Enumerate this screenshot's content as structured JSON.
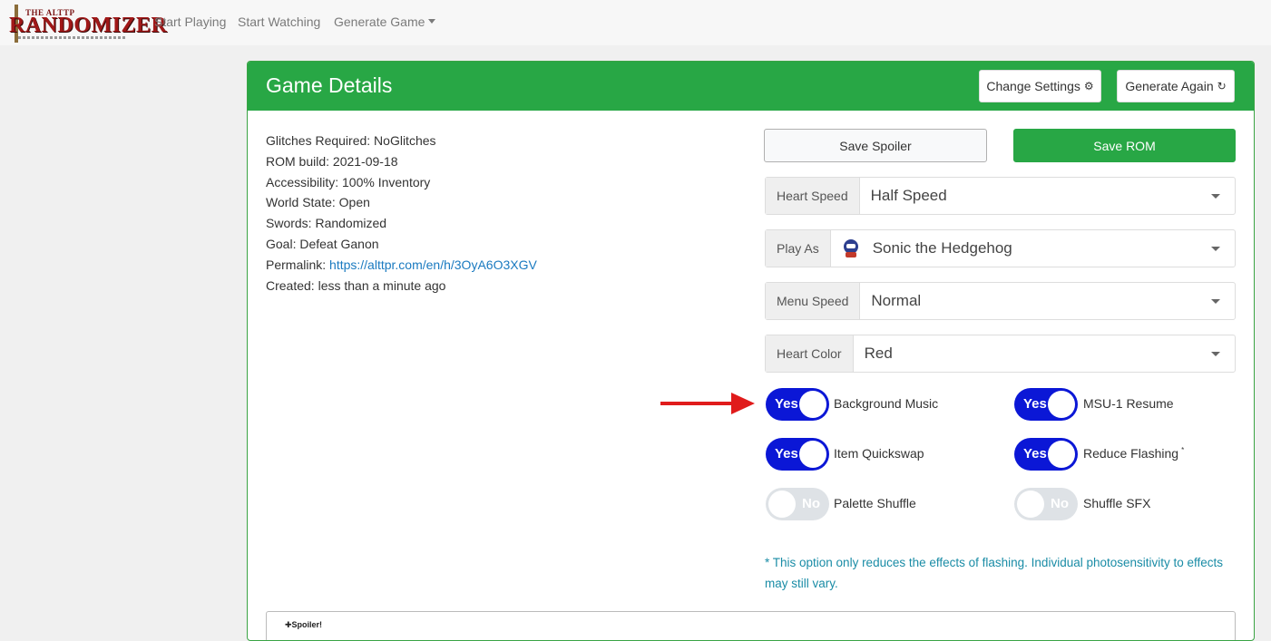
{
  "nav": {
    "logo_top": "THE ALTTP",
    "logo_main": "RANDOMIZER",
    "links": [
      "Start Playing",
      "Start Watching",
      "Generate Game"
    ]
  },
  "card": {
    "title": "Game Details",
    "change_settings": "Change Settings",
    "generate_again": "Generate Again"
  },
  "info": {
    "glitches": "Glitches Required: NoGlitches",
    "rom_build": "ROM build: 2021-09-18",
    "accessibility": "Accessibility: 100% Inventory",
    "world_state": "World State: Open",
    "swords": "Swords: Randomized",
    "goal": "Goal: Defeat Ganon",
    "permalink_label": "Permalink:",
    "permalink_url": "https://alttpr.com/en/h/3OyA6O3XGV",
    "created": "Created: less than a minute ago"
  },
  "actions": {
    "save_spoiler": "Save Spoiler",
    "save_rom": "Save ROM"
  },
  "selects": {
    "heart_speed": {
      "label": "Heart Speed",
      "value": "Half Speed"
    },
    "play_as": {
      "label": "Play As",
      "value": "Sonic the Hedgehog"
    },
    "menu_speed": {
      "label": "Menu Speed",
      "value": "Normal"
    },
    "heart_color": {
      "label": "Heart Color",
      "value": "Red"
    }
  },
  "toggles": {
    "yes": "Yes",
    "no": "No",
    "background_music": "Background Music",
    "msu_resume": "MSU-1 Resume",
    "item_quickswap": "Item Quickswap",
    "reduce_flashing": "Reduce Flashing",
    "reduce_flashing_mark": "*",
    "palette_shuffle": "Palette Shuffle",
    "shuffle_sfx": "Shuffle SFX"
  },
  "note": "* This option only reduces the effects of flashing. Individual photosensitivity to effects may still vary.",
  "spoiler": {
    "label": "Spoiler!"
  },
  "colors": {
    "green": "#28a745",
    "toggle_on": "#0b17d6",
    "toggle_off": "#dee2e6",
    "arrow": "#e01b1b",
    "link": "#1a7ac0",
    "note": "#1a8ca6"
  }
}
